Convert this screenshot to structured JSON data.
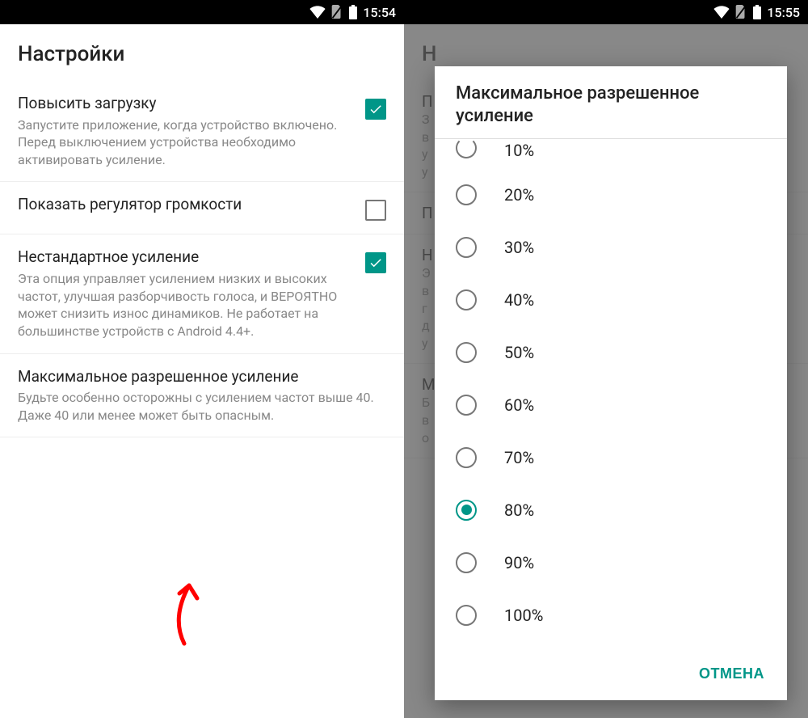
{
  "left": {
    "status": {
      "time": "15:54"
    },
    "title": "Настройки",
    "settings": [
      {
        "title": "Повысить загрузку",
        "desc": "Запустите приложение, когда устройство включено. Перед выключением устройства необходимо активировать усиление.",
        "checked": true
      },
      {
        "title": "Показать регулятор громкости",
        "desc": "",
        "checked": false
      },
      {
        "title": "Нестандартное усиление",
        "desc": "Эта опция управляет усилением низких и высоких частот, улучшая разборчивость голоса, и ВЕРОЯТНО может снизить износ динамиков. Не работает на большинстве устройств с Android 4.4+.",
        "checked": true
      },
      {
        "title": "Максимальное разрешенное усиление",
        "desc": "Будьте особенно осторожны с усилением частот выше 40. Даже 40 или менее может быть опасным.",
        "checked": null
      }
    ]
  },
  "right": {
    "status": {
      "time": "15:55"
    },
    "bg_title": "Н",
    "bg_rows": [
      {
        "title": "П",
        "desc": "З\nв\nу\nу"
      },
      {
        "title": "П",
        "desc": ""
      },
      {
        "title": "Н",
        "desc": "Э\nв\nг\nд\nу"
      },
      {
        "title": "М",
        "desc": "Б\nв\nо"
      }
    ],
    "dialog": {
      "title": "Максимальное разрешенное усиление",
      "options": [
        {
          "label": "10%",
          "selected": false,
          "cut": true
        },
        {
          "label": "20%",
          "selected": false
        },
        {
          "label": "30%",
          "selected": false
        },
        {
          "label": "40%",
          "selected": false
        },
        {
          "label": "50%",
          "selected": false
        },
        {
          "label": "60%",
          "selected": false
        },
        {
          "label": "70%",
          "selected": false
        },
        {
          "label": "80%",
          "selected": true
        },
        {
          "label": "90%",
          "selected": false
        },
        {
          "label": "100%",
          "selected": false
        }
      ],
      "cancel": "ОТМЕНА"
    }
  },
  "colors": {
    "accent": "#009688"
  }
}
